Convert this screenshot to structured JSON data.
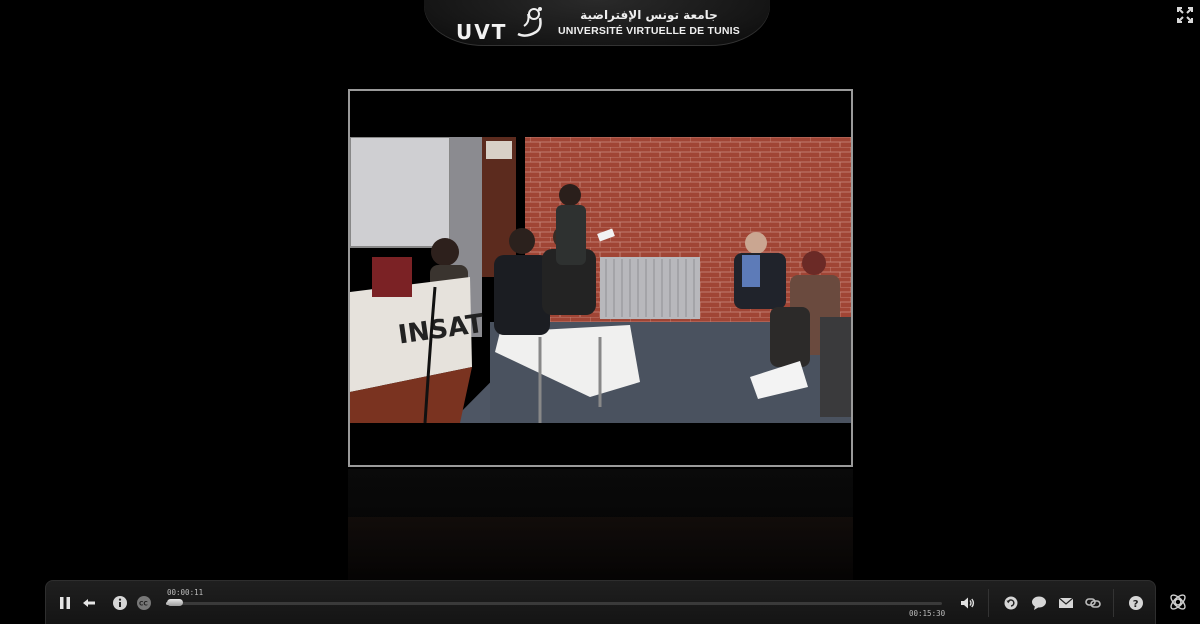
{
  "logo": {
    "short": "UVT",
    "arabic": "جامعة تونس الإفتراضية",
    "latin": "UNIVERSITÉ VIRTUELLE DE TUNIS"
  },
  "video": {
    "podium_text": "INSAT"
  },
  "player": {
    "time_current": "00:00:11",
    "time_total": "00:15:30",
    "progress_fraction": 0.012,
    "state": "playing"
  },
  "icons": {
    "fullscreen": "fullscreen-icon",
    "pause": "pause-icon",
    "back": "back-icon",
    "info": "info-icon",
    "cc": "closed-captions-icon",
    "volume": "volume-icon",
    "replay": "replay-icon",
    "comment": "comment-icon",
    "email": "email-icon",
    "link": "link-icon",
    "help": "help-icon",
    "settings": "network-settings-icon"
  },
  "colors": {
    "background": "#000000",
    "frame_border": "#9a9a9a",
    "brick": "#a84a3a"
  }
}
